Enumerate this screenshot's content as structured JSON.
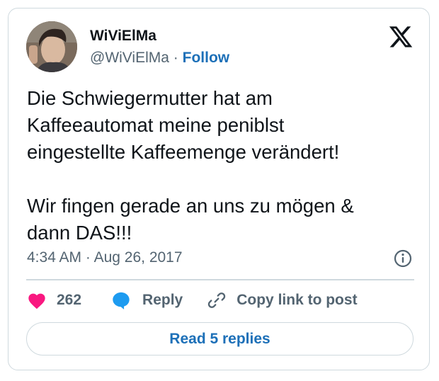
{
  "author": {
    "name": "WiViElMa",
    "handle": "@WiViElMa",
    "separator": "·",
    "follow_label": "Follow"
  },
  "tweet": {
    "text": "Die Schwiegermutter hat am\nKaffeeautomat meine peniblst\neingestellte Kaffeemenge verändert!\n\nWir fingen gerade an uns zu mögen &\ndann DAS!!!",
    "time": "4:34 AM",
    "date": "Aug 26, 2017",
    "meta_separator": "·"
  },
  "actions": {
    "like_count": "262",
    "reply_label": "Reply",
    "copy_label": "Copy link to post"
  },
  "read_replies_label": "Read 5 replies",
  "icons": {
    "logo": "x-logo-icon",
    "like": "heart-icon",
    "reply": "speech-bubble-icon",
    "copy": "link-icon",
    "info": "info-icon"
  },
  "colors": {
    "like": "#f91880",
    "reply": "#1d9bf0",
    "link_text": "#1d70b8",
    "secondary_text": "#536471",
    "border": "#cfd9de"
  }
}
